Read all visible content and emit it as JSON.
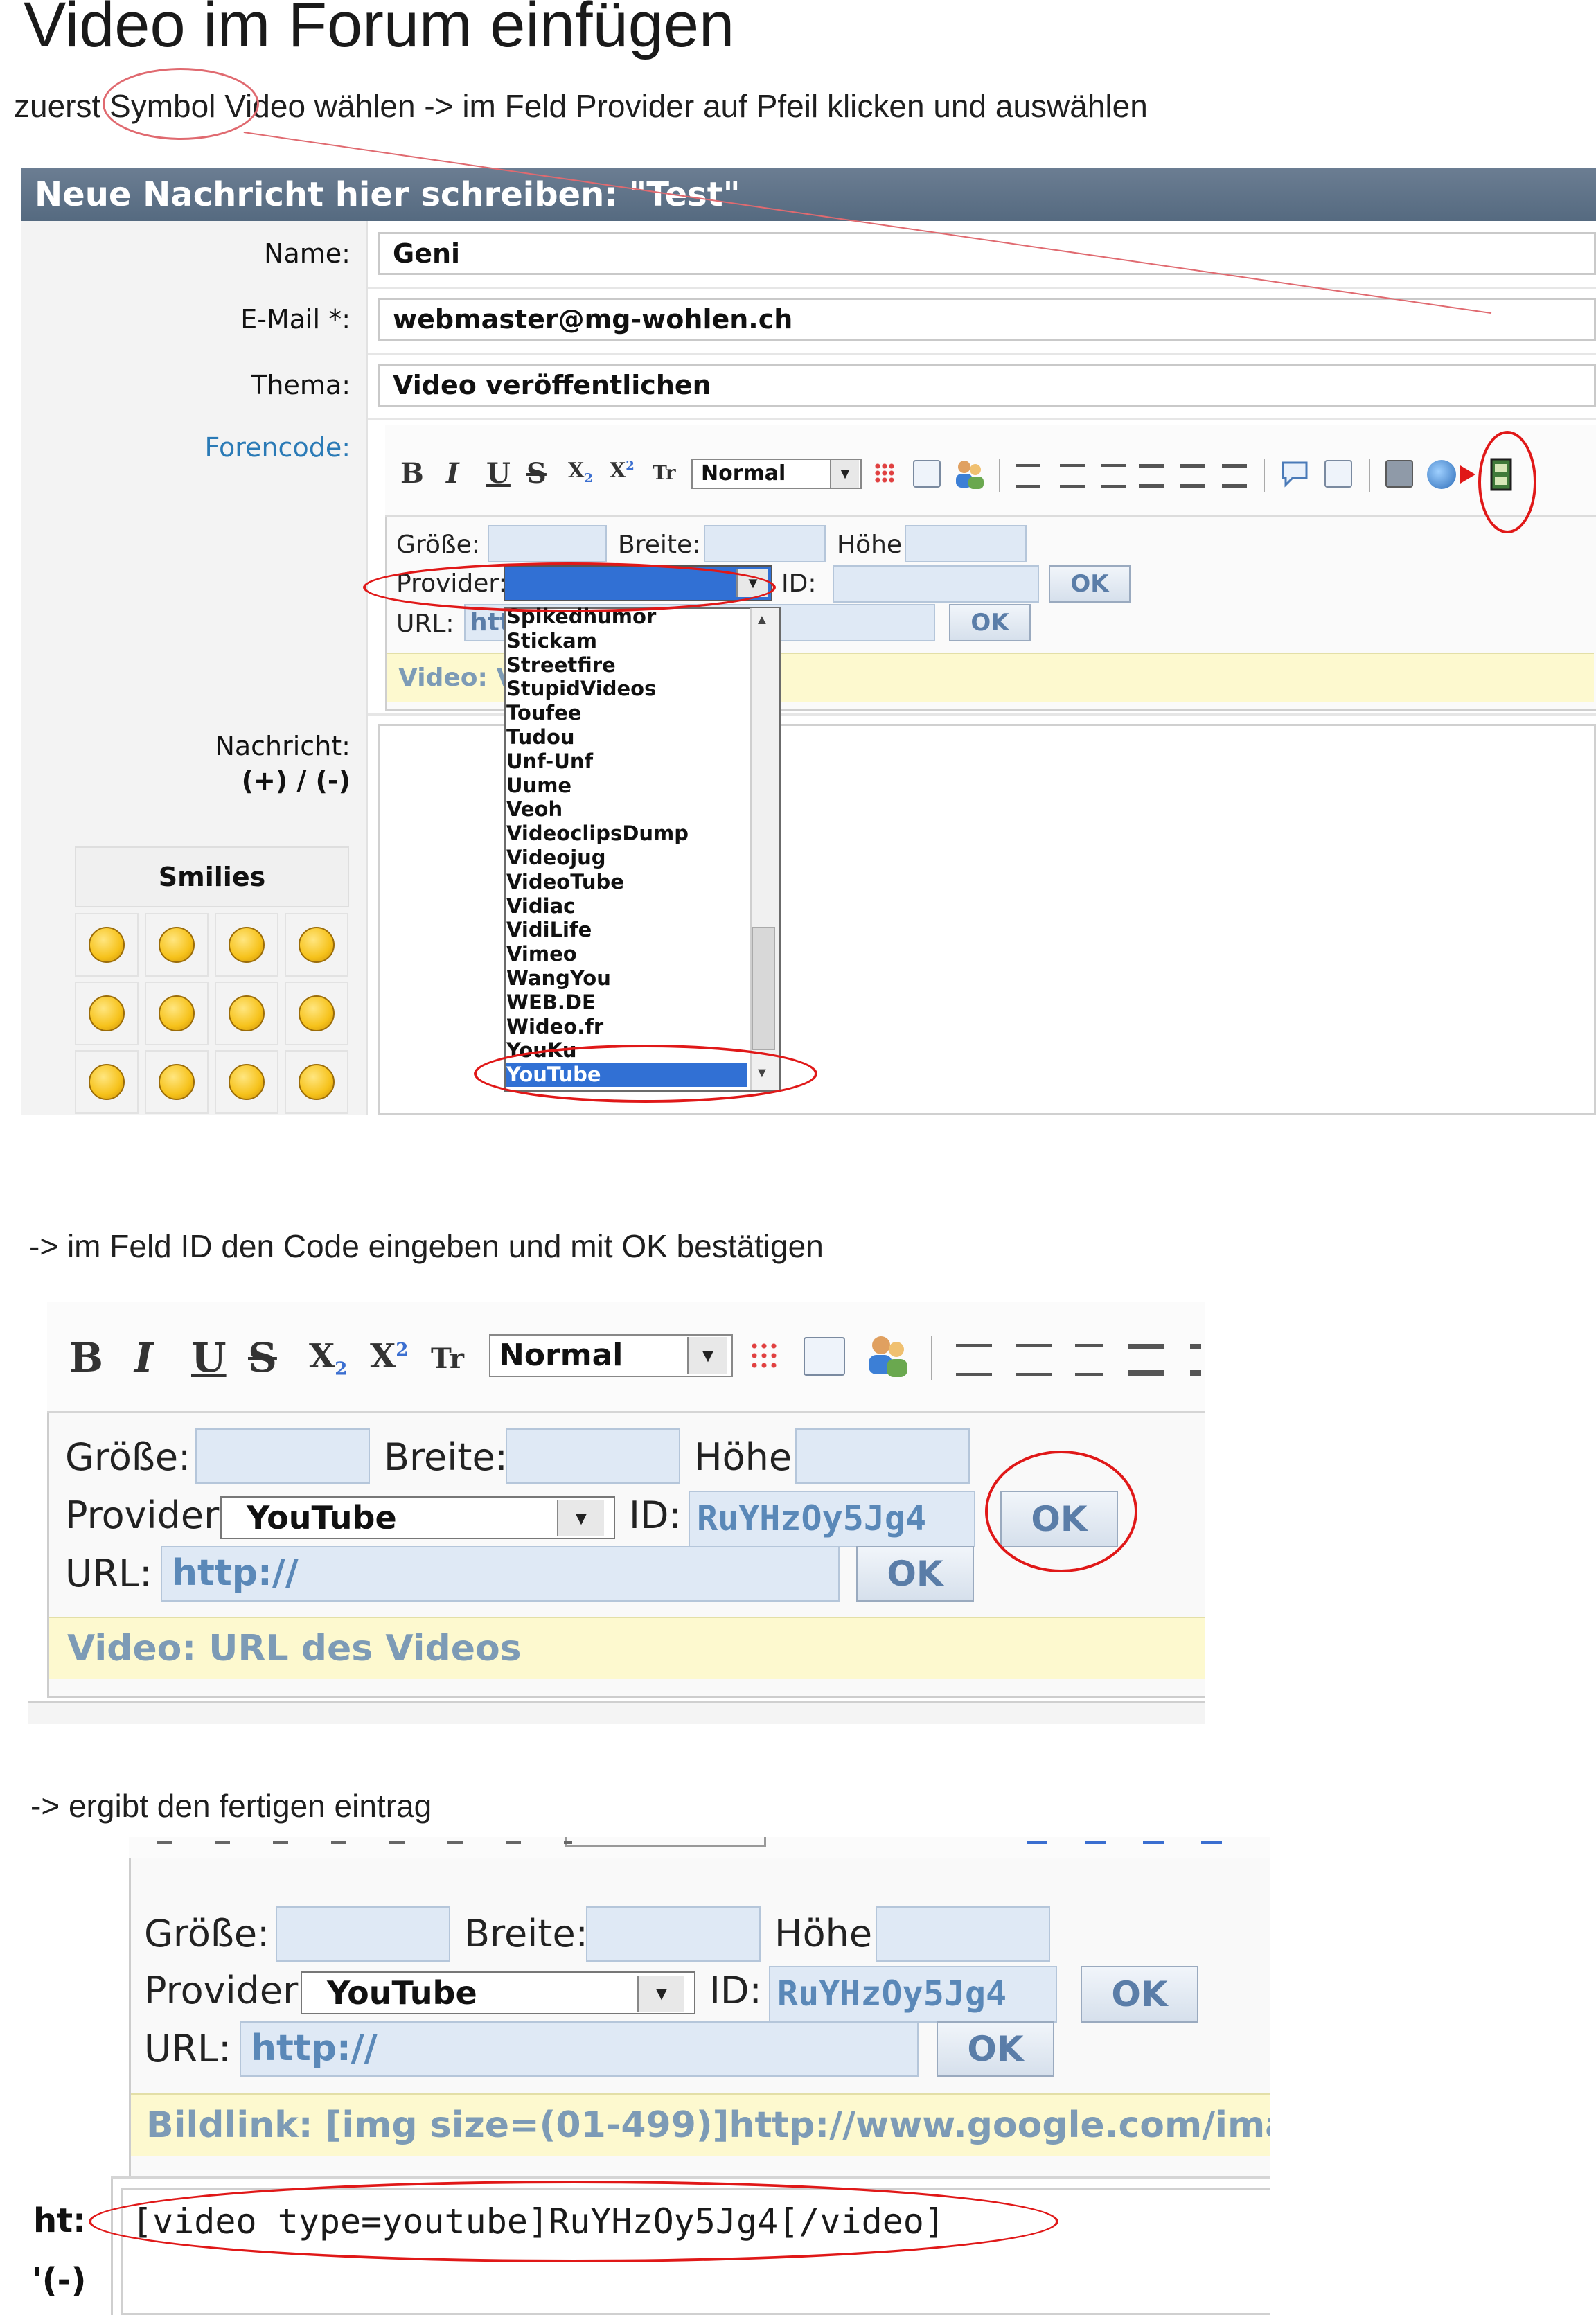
{
  "title": "Video im Forum einfügen",
  "instruction1": "zuerst Symbol Video wählen -> im Feld Provider auf Pfeil klicken und auswählen",
  "instruction2": "-> im Feld ID den Code eingeben und mit OK bestätigen",
  "instruction3": "-> ergibt den fertigen eintrag",
  "form": {
    "header": "Neue Nachricht hier schreiben: \"Test\"",
    "name_label": "Name:",
    "name_value": "Geni",
    "email_label": "E-Mail *:",
    "email_value": "webmaster@mg-wohlen.ch",
    "thema_label": "Thema:",
    "thema_value": "Video veröffentlichen",
    "forencode_label": "Forencode:",
    "nachricht_label": "Nachricht:",
    "plusminus": "(+) / (-)",
    "smilies_label": "Smilies"
  },
  "toolbar": {
    "bold": "B",
    "italic": "I",
    "underline": "U",
    "strike": "S",
    "sub": "X",
    "sub_index": "2",
    "sup": "X",
    "sup_index": "2",
    "tt": "Tr",
    "format_select": "Normal"
  },
  "video_panel": {
    "size_label": "Größe:",
    "width_label": "Breite:",
    "height_label": "Höhe:",
    "provider_label": "Provider:",
    "id_label": "ID:",
    "url_label": "URL:",
    "ok": "OK",
    "url_placeholder": "http://",
    "url_partial": "htt",
    "video_hint": "Video: URL des Videos",
    "video_hint_partial": "Video: V",
    "provider_selected": "YouTube",
    "id_value": "RuYHzOy5Jg4",
    "bildlink_hint": "Bildlink: [img size=(01-499)]http://www.google.com/ima"
  },
  "providers": [
    "Spikedhumor",
    "Stickam",
    "Streetfire",
    "StupidVideos",
    "Toufee",
    "Tudou",
    "Unf-Unf",
    "Uume",
    "Veoh",
    "VideoclipsDump",
    "Videojug",
    "VideoTube",
    "Vidiac",
    "VidiLife",
    "Vimeo",
    "WangYou",
    "WEB.DE",
    "Wideo.fr",
    "YouKu",
    "YouTube"
  ],
  "result": {
    "label_partial": "ht:",
    "plusminus_partial": "'(-)",
    "code": "[video type=youtube]RuYHzOy5Jg4[/video]"
  },
  "colors": {
    "header_bg": "#5f7389",
    "annotation_red": "#e01818",
    "hint_yellow": "#fdf9cf",
    "selected_blue": "#3170d4"
  }
}
